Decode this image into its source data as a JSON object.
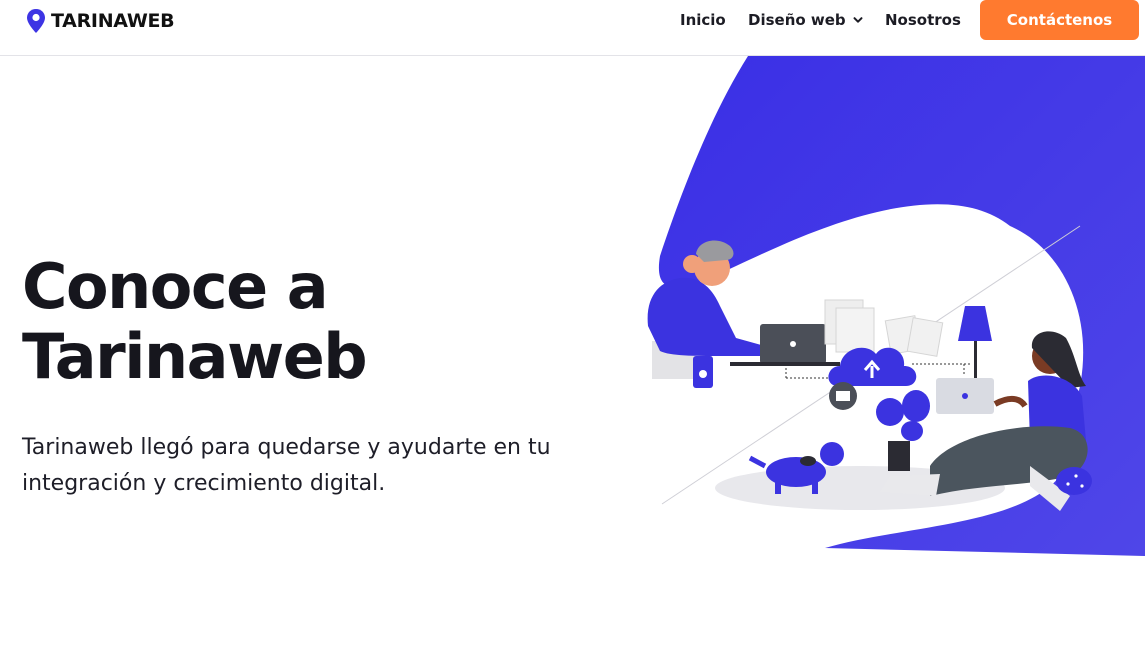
{
  "header": {
    "brand": "TARINAWEB",
    "nav": [
      {
        "label": "Inicio"
      },
      {
        "label": "Diseño web"
      },
      {
        "label": "Nosotros"
      }
    ],
    "cta_label": "Contáctenos"
  },
  "hero": {
    "title_line1": "Conoce a",
    "title_line2": "Tarinaweb",
    "subtitle": "Tarinaweb llegó para quedarse y ayudarte en tu integración y crecimiento digital."
  },
  "colors": {
    "brand_blue": "#3d34e4",
    "cta_orange": "#ff7a2f",
    "text_dark": "#16161d"
  },
  "icons": [
    "map-pin-icon",
    "chevron-down-icon"
  ]
}
